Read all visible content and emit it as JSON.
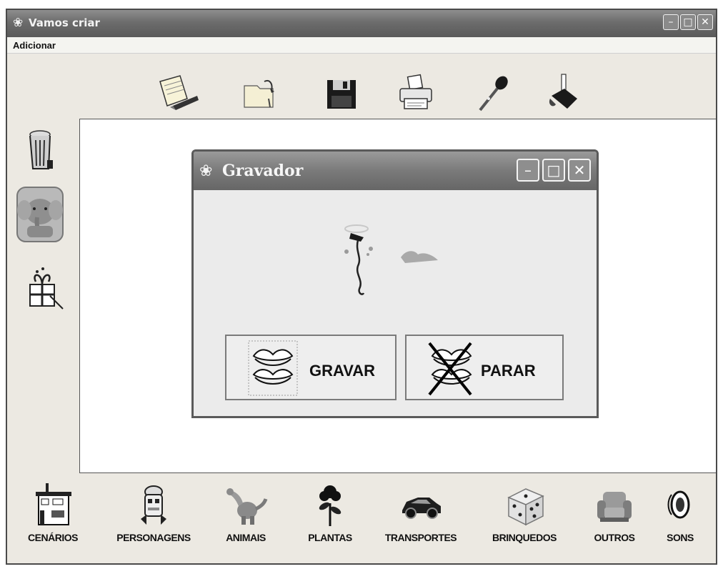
{
  "window": {
    "title": "Vamos criar",
    "controls": [
      "minimize-icon",
      "maximize-icon",
      "close-icon"
    ]
  },
  "menubar": {
    "items": [
      {
        "label": "Adicionar"
      }
    ]
  },
  "toolbar": {
    "tools": [
      {
        "icon": "notepad-pencil-icon"
      },
      {
        "icon": "open-folder-icon"
      },
      {
        "icon": "floppy-disk-save-icon"
      },
      {
        "icon": "printer-icon"
      },
      {
        "icon": "microphone-icon"
      },
      {
        "icon": "paint-bucket-icon"
      }
    ]
  },
  "left_tools": {
    "items": [
      {
        "icon": "trash-can-icon"
      },
      {
        "icon": "elephant-icon"
      },
      {
        "icon": "scissors-gift-icon"
      }
    ]
  },
  "dialog": {
    "title": "Gravador",
    "controls": [
      "minimize-icon",
      "maximize-icon",
      "close-icon"
    ],
    "illustration_icon": "microphone-sound-icon",
    "record_label": "GRAVAR",
    "stop_label": "PARAR"
  },
  "categories": [
    {
      "label": "CENÁRIOS",
      "icon": "building-icon"
    },
    {
      "label": "PERSONAGENS",
      "icon": "robot-icon"
    },
    {
      "label": "ANIMAIS",
      "icon": "dinosaur-icon"
    },
    {
      "label": "PLANTAS",
      "icon": "plant-icon"
    },
    {
      "label": "TRANSPORTES",
      "icon": "car-icon"
    },
    {
      "label": "BRINQUEDOS",
      "icon": "dice-icon"
    },
    {
      "label": "OUTROS",
      "icon": "armchair-icon"
    },
    {
      "label": "SONS",
      "icon": "speaker-icon"
    }
  ]
}
